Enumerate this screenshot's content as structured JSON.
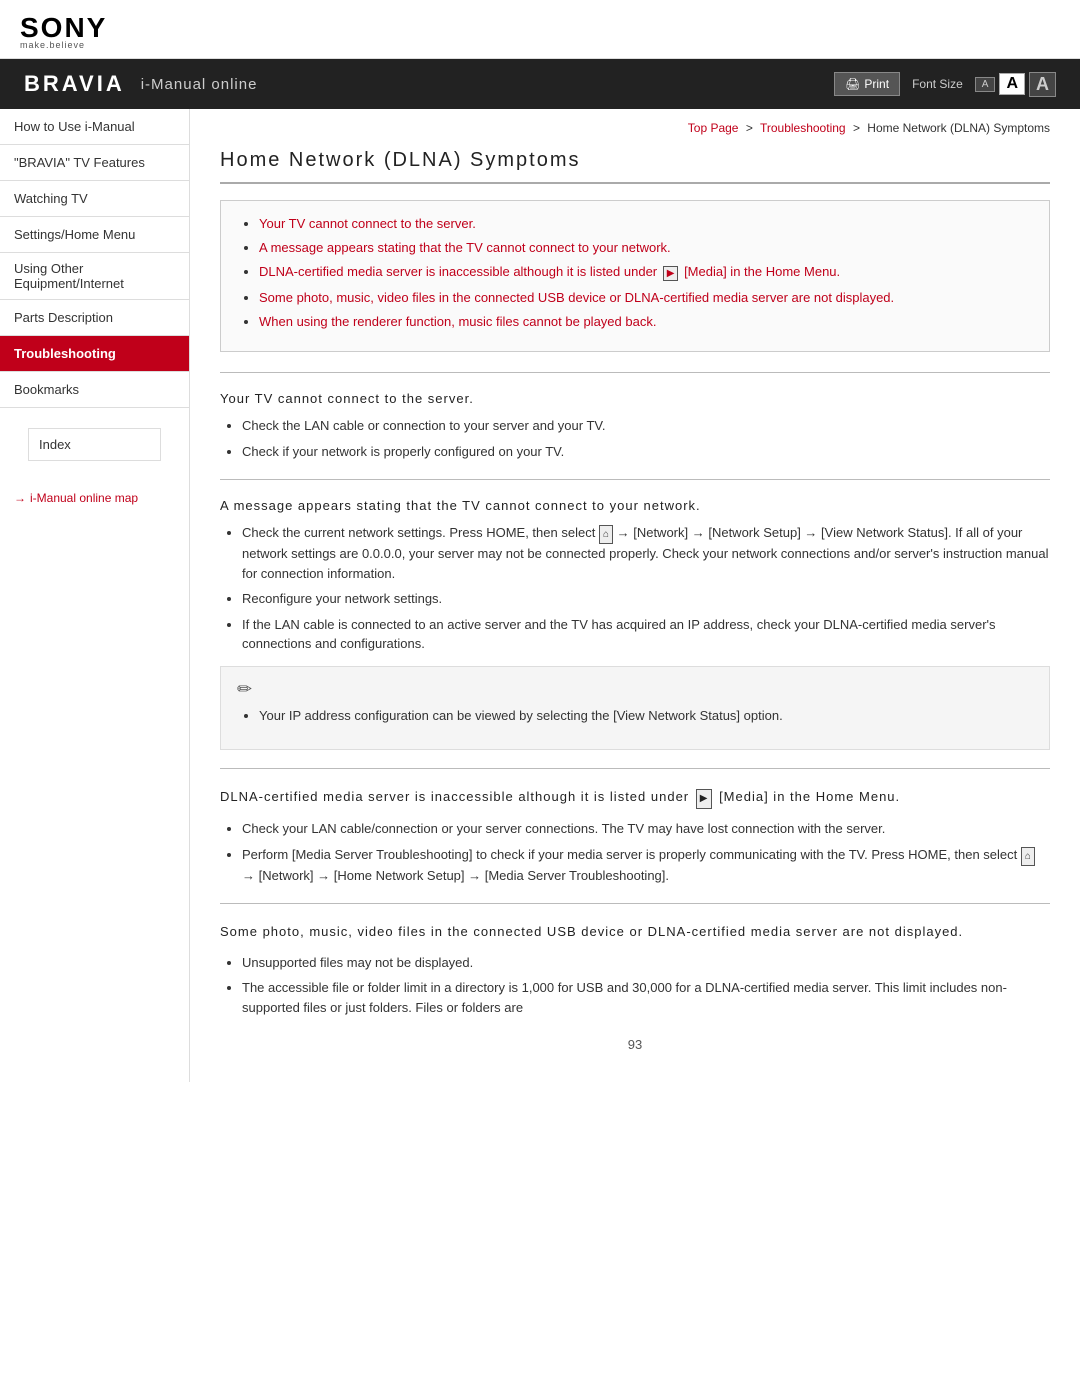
{
  "header": {
    "sony_text": "SONY",
    "sony_tagline": "make.believe",
    "bravia": "BRAVIA",
    "imanual": "i-Manual online",
    "print_btn": "Print",
    "font_size_label": "Font Size",
    "font_a_sm": "A",
    "font_a_md": "A",
    "font_a_lg": "A"
  },
  "breadcrumb": {
    "top_page": "Top Page",
    "sep1": ">",
    "troubleshooting": "Troubleshooting",
    "sep2": ">",
    "current": "Home Network (DLNA) Symptoms"
  },
  "page_title": "Home Network (DLNA) Symptoms",
  "link_box": {
    "items": [
      "Your TV cannot connect to the server.",
      "A message appears stating that the TV cannot connect to your network.",
      "DLNA-certified media server is inaccessible although it is listed under  [Media] in the Home Menu.",
      "Some photo, music, video files in the connected USB device or DLNA-certified media server are not displayed.",
      "When using the renderer function, music files cannot be played back."
    ]
  },
  "section1": {
    "heading": "Your TV cannot connect to the server.",
    "bullets": [
      "Check the LAN cable or connection to your server and your TV.",
      "Check if your network is properly configured on your TV."
    ]
  },
  "section2": {
    "heading": "A message appears stating that the TV cannot connect to your network.",
    "bullets": [
      "Check the current network settings. Press HOME, then select  → [Network] → [Network Setup] → [View Network Status]. If all of your network settings are 0.0.0.0, your server may not be connected properly. Check your network connections and/or server's instruction manual for connection information.",
      "Reconfigure your network settings.",
      "If the LAN cable is connected to an active server and the TV has acquired an IP address, check your DLNA-certified media server's connections and configurations."
    ]
  },
  "note": {
    "text": "Your IP address configuration can be viewed by selecting the [View Network Status] option."
  },
  "section3": {
    "heading": "DLNA-certified media server is inaccessible although it is listed under  [Media] in the Home Menu.",
    "bullets": [
      "Check your LAN cable/connection or your server connections. The TV may have lost connection with the server.",
      "Perform [Media Server Troubleshooting] to check if your media server is properly communicating with the TV. Press HOME, then select  → [Network] → [Home Network Setup] → [Media Server Troubleshooting]."
    ]
  },
  "section4": {
    "heading": "Some photo, music, video files in the connected USB device or DLNA-certified media server are not displayed.",
    "bullets": [
      "Unsupported files may not be displayed.",
      "The accessible file or folder limit in a directory is 1,000 for USB and 30,000 for a DLNA-certified media server. This limit includes non-supported files or just folders. Files or folders are"
    ]
  },
  "sidebar": {
    "items": [
      "How to Use i-Manual",
      "\"BRAVIA\" TV Features",
      "Watching TV",
      "Settings/Home Menu",
      "Using Other Equipment/Internet",
      "Parts Description",
      "Troubleshooting",
      "Bookmarks"
    ],
    "index": "Index",
    "map_link": "i-Manual online map"
  },
  "page_number": "93"
}
